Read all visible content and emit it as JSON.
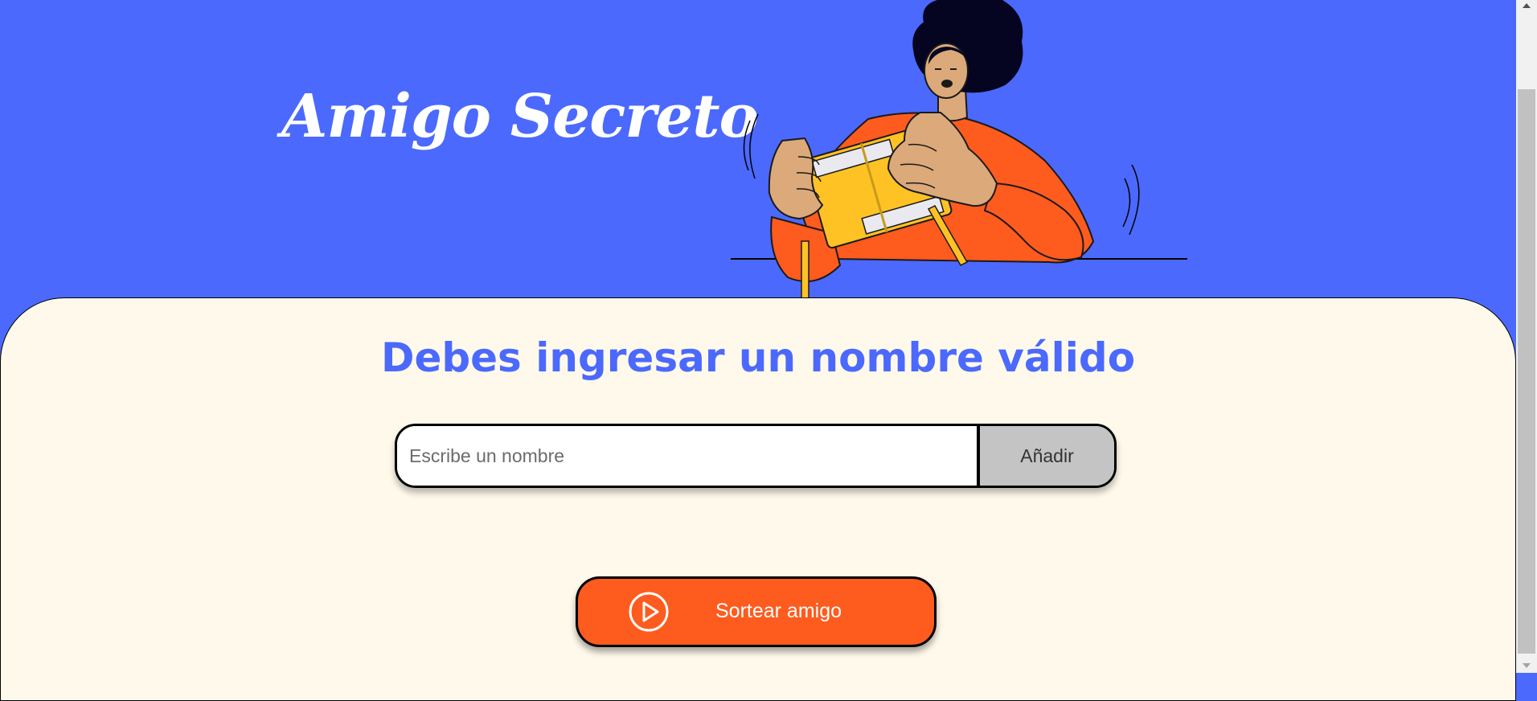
{
  "header": {
    "title": "Amigo Secreto",
    "illustration_icon": "person-shaking-gift-box-illustration"
  },
  "main": {
    "title": "Debes ingresar un nombre válido",
    "name_input": {
      "placeholder": "Escribe un nombre",
      "value": ""
    },
    "add_button_label": "Añadir",
    "draw_button": {
      "label": "Sortear amigo",
      "icon": "play-circle-icon"
    }
  },
  "colors": {
    "header_background": "#4b69fd",
    "main_background": "#fff9eb",
    "title_accent": "#4b69fd",
    "draw_button": "#fe5b1e",
    "add_button": "#c4c4c4"
  }
}
